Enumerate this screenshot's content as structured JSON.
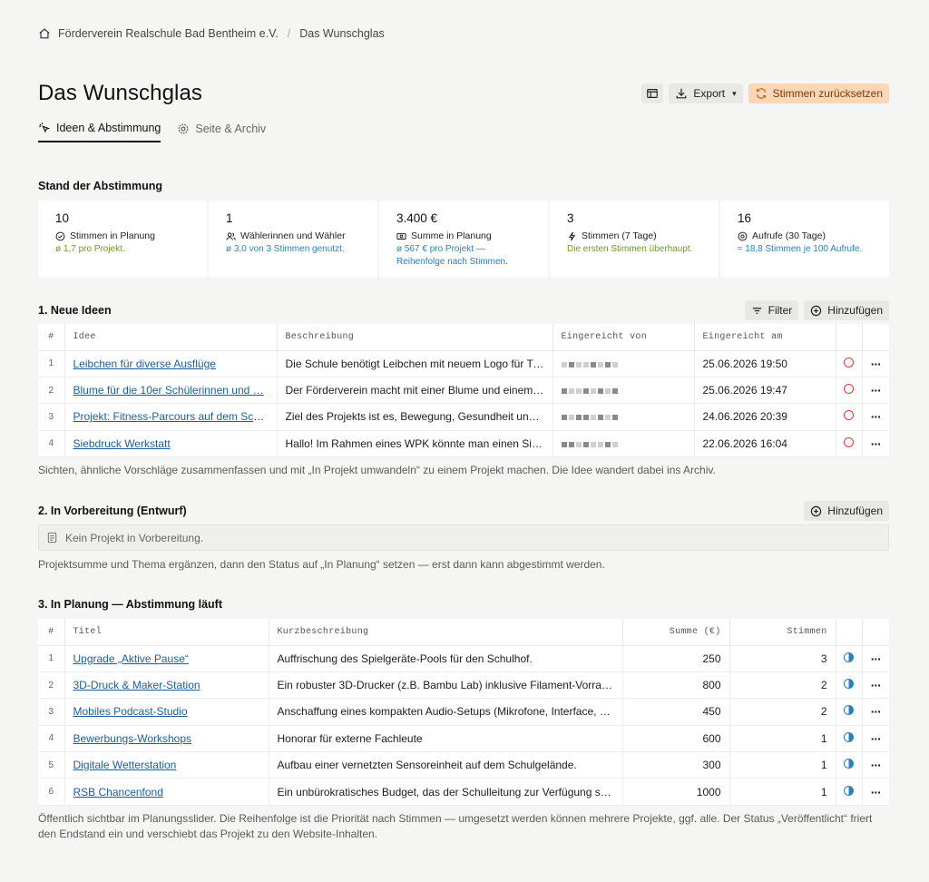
{
  "breadcrumb": {
    "org": "Förderverein Realschule Bad Bentheim e.V.",
    "page": "Das Wunschglas"
  },
  "header": {
    "title": "Das Wunschglas",
    "export_label": "Export",
    "reset_label": "Stimmen zurücksetzen"
  },
  "tabs": [
    {
      "label": "Ideen & Abstimmung"
    },
    {
      "label": "Seite & Archiv"
    }
  ],
  "stats_title": "Stand der Abstimmung",
  "stats": [
    {
      "value": "10",
      "label": "Stimmen in Planung",
      "sub": "ø 1,7 pro Projekt.",
      "icon": "check-circle-icon"
    },
    {
      "value": "1",
      "label": "Wählerinnen und Wähler",
      "sub": "ø 3,0 von 3 Stimmen genutzt.",
      "icon": "users-icon"
    },
    {
      "value": "3.400 €",
      "label": "Summe in Planung",
      "sub": "ø 567 € pro Projekt — Reihenfolge nach Stimmen.",
      "icon": "cash-icon"
    },
    {
      "value": "3",
      "label": "Stimmen (7 Tage)",
      "sub": "Die ersten Stimmen überhaupt.",
      "icon": "bolt-icon"
    },
    {
      "value": "16",
      "label": "Aufrufe (30 Tage)",
      "sub": "≈ 18,8 Stimmen je 100 Aufrufe.",
      "icon": "eye-icon"
    }
  ],
  "ideas": {
    "title": "1. Neue Ideen",
    "filter_label": "Filter",
    "add_label": "Hinzufügen",
    "columns": [
      "#",
      "Idee",
      "Beschreibung",
      "Eingereicht von",
      "Eingereicht am"
    ],
    "rows": [
      {
        "n": "1",
        "idea": "Leibchen für diverse Ausflüge",
        "desc": "Die Schule benötigt Leibchen mit neuem Logo für Tu…",
        "date": "25.06.2026 19:50"
      },
      {
        "n": "2",
        "idea": "Blume für die 10er Schülerinnen und …",
        "desc": "Der Förderverein macht mit einer Blume und einem G…",
        "date": "25.06.2026 19:47"
      },
      {
        "n": "3",
        "idea": "Projekt: Fitness-Parcours auf dem Sch…",
        "desc": "Ziel des Projekts ist es, Bewegung, Gesundheit und …",
        "date": "24.06.2026 20:39"
      },
      {
        "n": "4",
        "idea": "Siebdruck Werkstatt",
        "desc": "Hallo! Im Rahmen eines WPK könnte man einen Sieb…",
        "date": "22.06.2026 16:04"
      }
    ],
    "note": "Sichten, ähnliche Vorschläge zusammenfassen und mit „In Projekt umwandeln“ zu einem Projekt machen. Die Idee wandert dabei ins Archiv."
  },
  "prep": {
    "title": "2. In Vorbereitung (Entwurf)",
    "add_label": "Hinzufügen",
    "empty": "Kein Projekt in Vorbereitung.",
    "note": "Projektsumme und Thema ergänzen, dann den Status auf „In Planung“ setzen — erst dann kann abgestimmt werden."
  },
  "planning": {
    "title": "3. In Planung — Abstimmung läuft",
    "columns": [
      "#",
      "Titel",
      "Kurzbeschreibung",
      "Summe (€)",
      "Stimmen"
    ],
    "rows": [
      {
        "n": "1",
        "title": "Upgrade „Aktive Pause“",
        "desc": "Auffrischung des Spielgeräte-Pools für den Schulhof.",
        "sum": "250",
        "votes": "3"
      },
      {
        "n": "2",
        "title": "3D-Druck & Maker-Station",
        "desc": "Ein robuster 3D-Drucker (z.B. Bambu Lab) inklusive Filament-Vorrat f…",
        "sum": "800",
        "votes": "2"
      },
      {
        "n": "3",
        "title": "Mobiles Podcast-Studio",
        "desc": "Anschaffung eines kompakten Audio-Setups (Mikrofone, Interface, K…",
        "sum": "450",
        "votes": "2"
      },
      {
        "n": "4",
        "title": "Bewerbungs-Workshops",
        "desc": "Honorar für externe Fachleute",
        "sum": "600",
        "votes": "1"
      },
      {
        "n": "5",
        "title": "Digitale Wetterstation",
        "desc": "Aufbau einer vernetzten Sensoreinheit auf dem Schulgelände.",
        "sum": "300",
        "votes": "1"
      },
      {
        "n": "6",
        "title": "RSB Chancenfond",
        "desc": "Ein unbürokratisches Budget, das der Schulleitung zur Verfügung ste…",
        "sum": "1000",
        "votes": "1"
      }
    ],
    "note": "Öffentlich sichtbar im Planungsslider. Die Reihenfolge ist die Priorität nach Stimmen — umgesetzt werden können mehrere Projekte, ggf. alle. Der Status „Veröffentlicht“ friert den Endstand ein und verschiebt das Projekt zu den Website-Inhalten."
  },
  "colors": {
    "accent_link": "#1a5fa0",
    "warn_bg": "#fbd7b8",
    "ring_red": "#e03a3a",
    "stat_green": "#6a9a1f",
    "stat_blue": "#2b7fc0"
  }
}
